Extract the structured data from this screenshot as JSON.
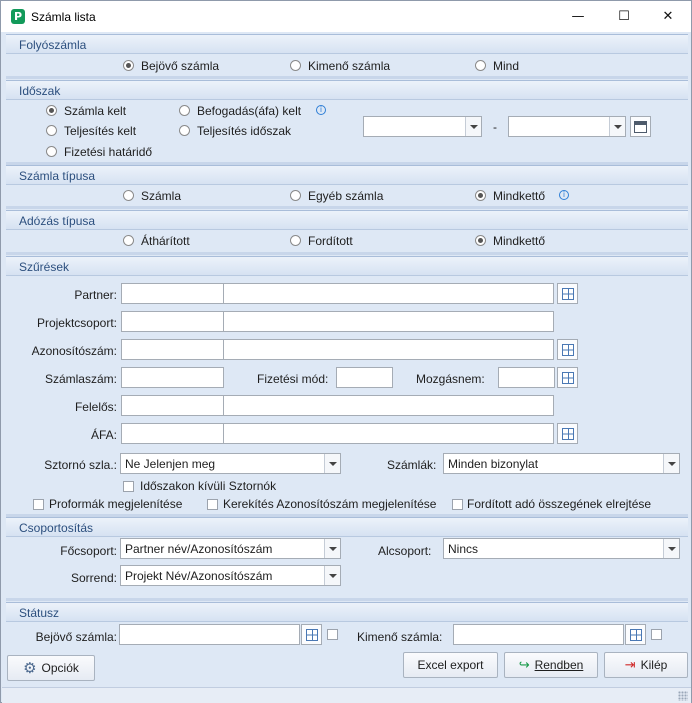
{
  "window": {
    "title": "Számla lista",
    "app_icon_letter": "P",
    "minimize_glyph": "—",
    "maximize_glyph": "☐",
    "close_glyph": "✕"
  },
  "folyoszamla": {
    "title": "Folyószámla",
    "options": [
      "Bejövő számla",
      "Kimenő számla",
      "Mind"
    ],
    "selected": "Bejövő számla"
  },
  "idoszak": {
    "title": "Időszak",
    "options": [
      "Számla kelt",
      "Teljesítés kelt",
      "Fizetési határidő",
      "Befogadás(áfa) kelt",
      "Teljesítés időszak"
    ],
    "selected": "Számla kelt",
    "date_from": "",
    "date_to": "",
    "date_separator": "-"
  },
  "szamla_tipusa": {
    "title": "Számla típusa",
    "options": [
      "Számla",
      "Egyéb számla",
      "Mindkettő"
    ],
    "selected": "Mindkettő"
  },
  "adozas_tipusa": {
    "title": "Adózás típusa",
    "options": [
      "Áthárított",
      "Fordított",
      "Mindkettő"
    ],
    "selected": "Mindkettő"
  },
  "szuresek": {
    "title": "Szűrések",
    "partner_label": "Partner:",
    "projektcsoport_label": "Projektcsoport:",
    "azonositoszam_label": "Azonosítószám:",
    "szamlaszam_label": "Számlaszám:",
    "fizetesi_mod_label": "Fizetési mód:",
    "mozgasnem_label": "Mozgásnem:",
    "felelos_label": "Felelős:",
    "afa_label": "ÁFA:",
    "sztorno_label": "Sztornó szla.:",
    "sztorno_value": "Ne Jelenjen meg",
    "szamlak_label": "Számlák:",
    "szamlak_value": "Minden bizonylat",
    "checks": {
      "idoszakon_kivuli": "Időszakon kívüli Sztornók",
      "proformak": "Proformák megjelenítése",
      "kerekites": "Kerekítés Azonosítószám megjelenítése",
      "forditott": "Fordított adó összegének elrejtése"
    }
  },
  "csoportositas": {
    "title": "Csoportosítás",
    "focsoport_label": "Főcsoport:",
    "focsoport_value": "Partner név/Azonosítószám",
    "alcsoport_label": "Alcsoport:",
    "alcsoport_value": "Nincs",
    "sorrend_label": "Sorrend:",
    "sorrend_value": "Projekt Név/Azonosítószám"
  },
  "statusz": {
    "title": "Státusz",
    "bejovo_label": "Bejövő számla:",
    "kimeno_label": "Kimenő számla:"
  },
  "buttons": {
    "opciok": "Opciók",
    "excel": "Excel export",
    "rendben": "Rendben",
    "kilep": "Kilép"
  },
  "colors": {
    "panel_bg": "#dee8f5",
    "group_title": "#2c4f7e",
    "info_icon": "#2f7fd6",
    "rendben_icon": "#1a9a4a",
    "kilep_icon": "#d02a2a"
  }
}
